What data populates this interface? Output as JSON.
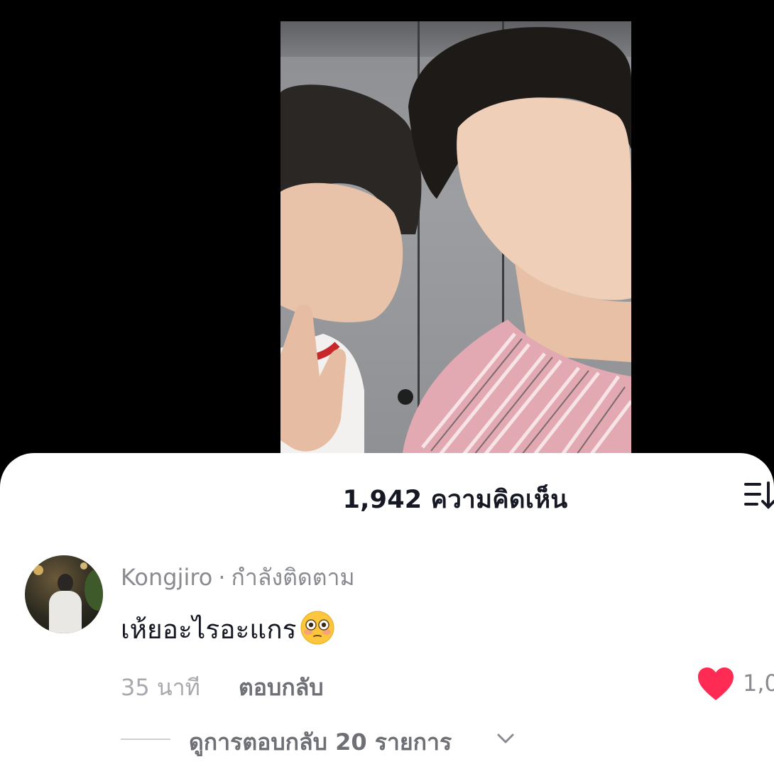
{
  "video": {
    "description_icon": "video-frame"
  },
  "comments_sheet": {
    "title": "1,942 ความคิดเห็น",
    "sort_icon": "sort-list-icon"
  },
  "comment": {
    "username": "Kongjiro",
    "separator": "·",
    "relationship": "กำลังติดตาม",
    "text": "เห้ยอะไรอะแกร",
    "emoji": "flushed-face-emoji",
    "time": "35 นาที",
    "reply_label": "ตอบกลับ",
    "like_icon": "heart-icon",
    "like_color": "#fe2c55",
    "like_count": "1,0",
    "view_replies_label": "ดูการตอบกลับ 20 รายการ",
    "view_replies_icon": "chevron-down-icon"
  }
}
